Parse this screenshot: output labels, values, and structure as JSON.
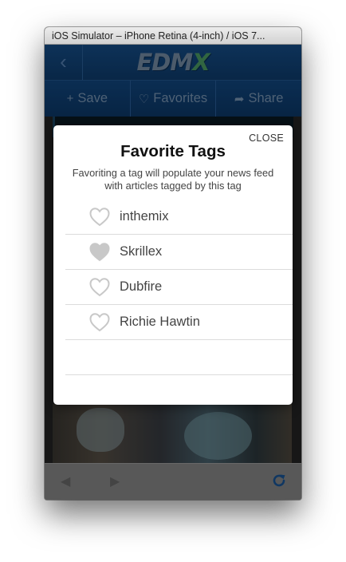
{
  "window": {
    "title": "iOS Simulator – iPhone Retina (4-inch) / iOS 7..."
  },
  "app": {
    "logo_main": "EDM",
    "logo_accent": "X",
    "actions": [
      {
        "icon": "plus-icon",
        "glyph": "+",
        "label": "Save"
      },
      {
        "icon": "heart-outline-icon",
        "glyph": "♡",
        "label": "Favorites"
      },
      {
        "icon": "share-arrow-icon",
        "glyph": "➦",
        "label": "Share"
      }
    ]
  },
  "modal": {
    "close_label": "CLOSE",
    "title": "Favorite Tags",
    "description": "Favoriting a tag will populate your news feed with articles tagged by this tag",
    "tags": [
      {
        "label": "inthemix",
        "favorited": false
      },
      {
        "label": "Skrillex",
        "favorited": true
      },
      {
        "label": "Dubfire",
        "favorited": false
      },
      {
        "label": "Richie Hawtin",
        "favorited": false
      }
    ]
  },
  "toolbar": {
    "back_icon": "left-triangle-icon",
    "forward_icon": "right-triangle-icon",
    "refresh_icon": "refresh-icon"
  },
  "colors": {
    "header_blue": "#16518f",
    "refresh_blue": "#1a5a9e",
    "heart_grey": "#c8c8c8"
  }
}
